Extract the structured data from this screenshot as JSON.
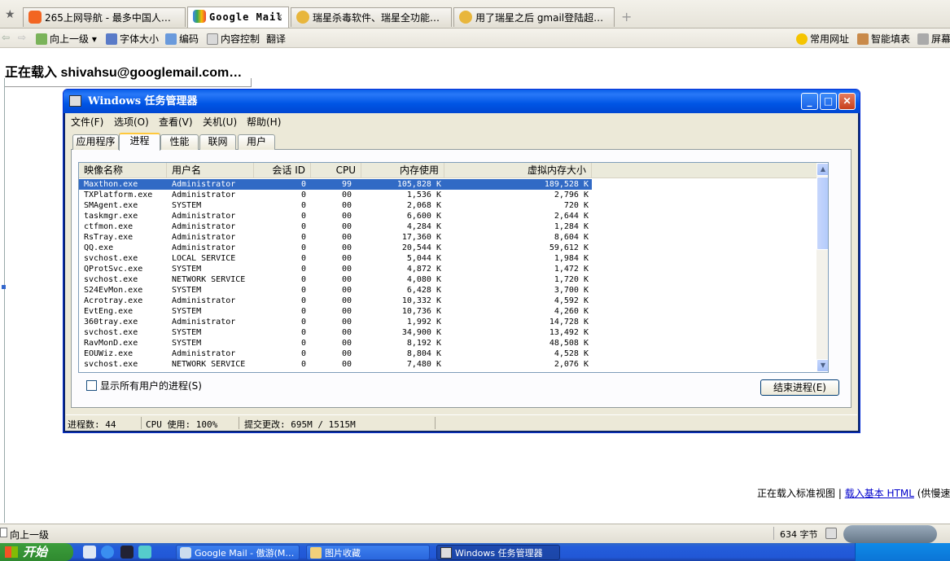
{
  "browser": {
    "tabs": [
      {
        "label": "265上网导航 - 最多中国人…",
        "active": false
      },
      {
        "label": "Google Mail",
        "active": true
      },
      {
        "label": "瑞星杀毒软件、瑞星全功能…",
        "active": false
      },
      {
        "label": "用了瑞星之后 gmail登陆超…",
        "active": false
      }
    ],
    "new_tab": "+",
    "toolbar": {
      "up": "向上一级",
      "font_size": "字体大小",
      "encoding": "编码",
      "content_control": "内容控制",
      "translate": "翻译",
      "favorites": "常用网址",
      "autofill": "智能填表",
      "screen": "屏幕"
    }
  },
  "page": {
    "loading_text": "正在载入  shivahsu@googlemail.com…",
    "bottom_text": "正在载入标准视图 | ",
    "bottom_link": "载入基本 HTML",
    "bottom_tail": " (供慢速"
  },
  "task_manager": {
    "title": "Windows 任务管理器",
    "menu": [
      "文件(F)",
      "选项(O)",
      "查看(V)",
      "关机(U)",
      "帮助(H)"
    ],
    "tabs": [
      "应用程序",
      "进程",
      "性能",
      "联网",
      "用户"
    ],
    "active_tab": "进程",
    "columns": [
      "映像名称",
      "用户名",
      "会话 ID",
      "CPU",
      "内存使用",
      "虚拟内存大小"
    ],
    "processes": [
      [
        "Maxthon.exe",
        "Administrator",
        "0",
        "99",
        "105,828 K",
        "189,528 K"
      ],
      [
        "TXPlatform.exe",
        "Administrator",
        "0",
        "00",
        "1,536 K",
        "2,796 K"
      ],
      [
        "SMAgent.exe",
        "SYSTEM",
        "0",
        "00",
        "2,068 K",
        "720 K"
      ],
      [
        "taskmgr.exe",
        "Administrator",
        "0",
        "00",
        "6,600 K",
        "2,644 K"
      ],
      [
        "ctfmon.exe",
        "Administrator",
        "0",
        "00",
        "4,284 K",
        "1,284 K"
      ],
      [
        "RsTray.exe",
        "Administrator",
        "0",
        "00",
        "17,360 K",
        "8,604 K"
      ],
      [
        "QQ.exe",
        "Administrator",
        "0",
        "00",
        "20,544 K",
        "59,612 K"
      ],
      [
        "svchost.exe",
        "LOCAL SERVICE",
        "0",
        "00",
        "5,044 K",
        "1,984 K"
      ],
      [
        "QProtSvc.exe",
        "SYSTEM",
        "0",
        "00",
        "4,872 K",
        "1,472 K"
      ],
      [
        "svchost.exe",
        "NETWORK SERVICE",
        "0",
        "00",
        "4,080 K",
        "1,720 K"
      ],
      [
        "S24EvMon.exe",
        "SYSTEM",
        "0",
        "00",
        "6,428 K",
        "3,700 K"
      ],
      [
        "Acrotray.exe",
        "Administrator",
        "0",
        "00",
        "10,332 K",
        "4,592 K"
      ],
      [
        "EvtEng.exe",
        "SYSTEM",
        "0",
        "00",
        "10,736 K",
        "4,260 K"
      ],
      [
        "360tray.exe",
        "Administrator",
        "0",
        "00",
        "1,992 K",
        "14,728 K"
      ],
      [
        "svchost.exe",
        "SYSTEM",
        "0",
        "00",
        "34,900 K",
        "13,492 K"
      ],
      [
        "RavMonD.exe",
        "SYSTEM",
        "0",
        "00",
        "8,192 K",
        "48,508 K"
      ],
      [
        "EOUWiz.exe",
        "Administrator",
        "0",
        "00",
        "8,804 K",
        "4,528 K"
      ],
      [
        "svchost.exe",
        "NETWORK SERVICE",
        "0",
        "00",
        "7,480 K",
        "2,076 K"
      ]
    ],
    "show_all_users": "显示所有用户的进程(S)",
    "end_process": "结束进程(E)",
    "status": {
      "process_count": "进程数: 44",
      "cpu_usage": "CPU 使用: 100%",
      "commit": "提交更改: 695M / 1515M"
    }
  },
  "firefox_status": {
    "left": "向上一级",
    "bytes": "634 字节"
  },
  "taskbar": {
    "start": "开始",
    "items": [
      {
        "label": "Google Mail - 傲游(M…",
        "active": false
      },
      {
        "label": "图片收藏",
        "active": false
      },
      {
        "label": "Windows 任务管理器",
        "active": true
      }
    ]
  },
  "colors": {
    "xp_blue": "#0055e5",
    "selection": "#316ac5",
    "link": "#0000cc"
  }
}
